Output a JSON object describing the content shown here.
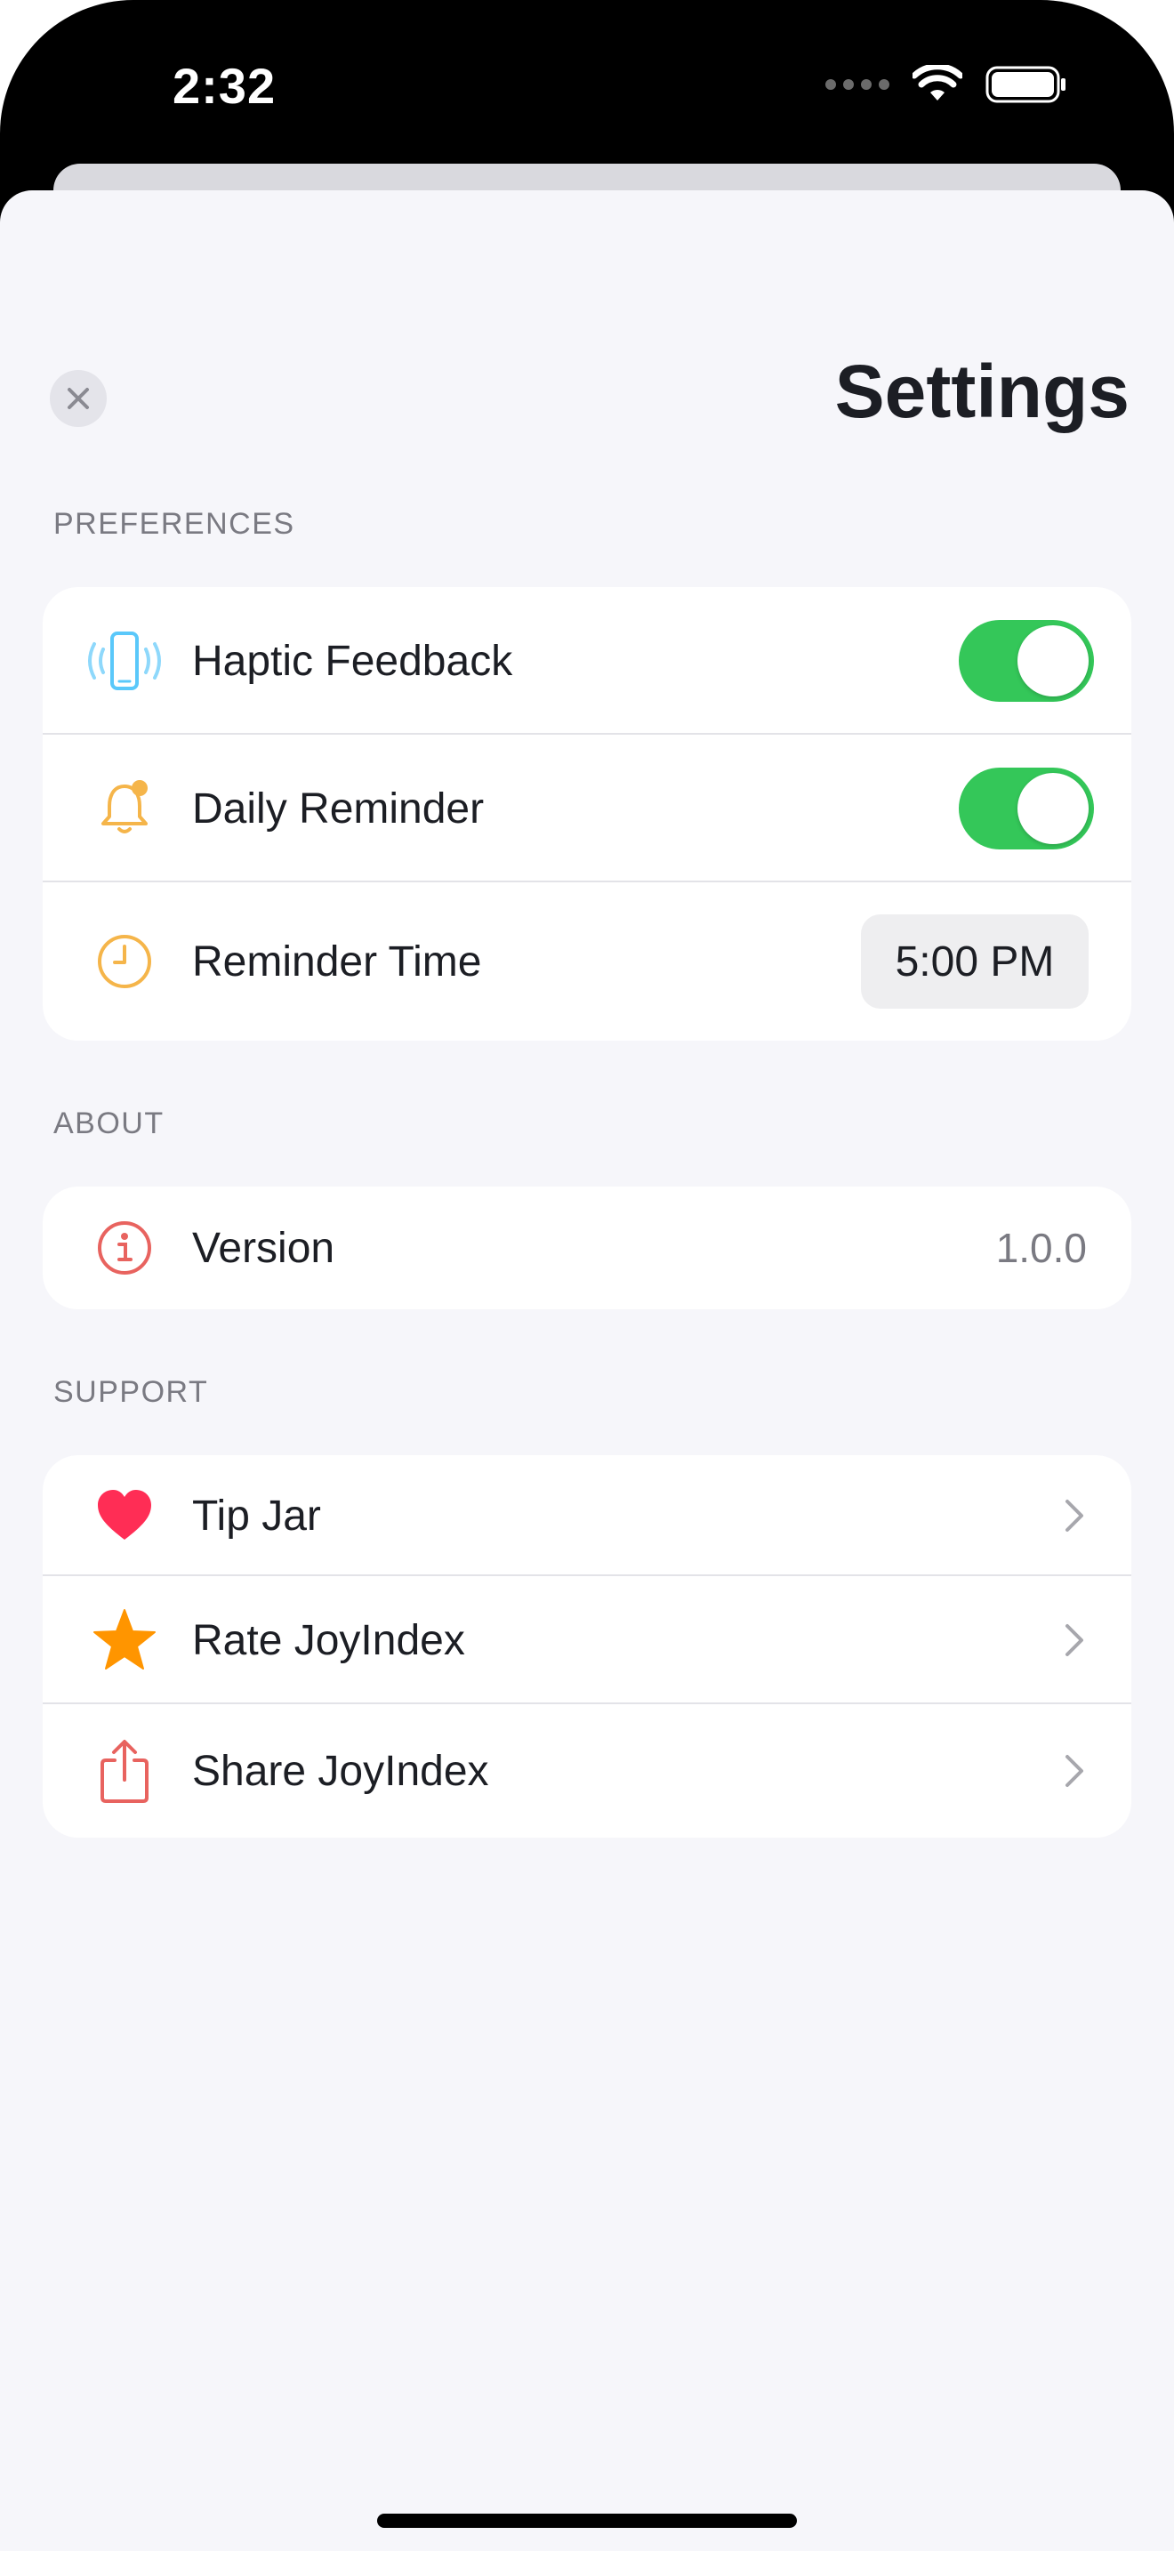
{
  "status_bar": {
    "time": "2:32"
  },
  "header": {
    "title": "Settings"
  },
  "sections": {
    "preferences": {
      "label": "PREFERENCES",
      "haptic": {
        "label": "Haptic Feedback",
        "enabled": true
      },
      "daily_reminder": {
        "label": "Daily Reminder",
        "enabled": true
      },
      "reminder_time": {
        "label": "Reminder Time",
        "value": "5:00 PM"
      }
    },
    "about": {
      "label": "ABOUT",
      "version": {
        "label": "Version",
        "value": "1.0.0"
      }
    },
    "support": {
      "label": "SUPPORT",
      "tip_jar": {
        "label": "Tip Jar"
      },
      "rate": {
        "label": "Rate JoyIndex"
      },
      "share": {
        "label": "Share JoyIndex"
      }
    }
  },
  "colors": {
    "toggle_on": "#34c759",
    "haptic_icon": "#5ac8fa",
    "bell_icon": "#f5b54a",
    "clock_icon": "#f5b54a",
    "info_icon": "#e8635f",
    "heart_icon": "#ff2d55",
    "star_icon": "#ff9500",
    "share_icon": "#e8635f"
  },
  "icons": [
    "close-icon",
    "haptic-phone-icon",
    "bell-icon",
    "clock-icon",
    "info-icon",
    "heart-icon",
    "star-icon",
    "share-icon",
    "chevron-right-icon",
    "wifi-icon",
    "battery-icon"
  ]
}
